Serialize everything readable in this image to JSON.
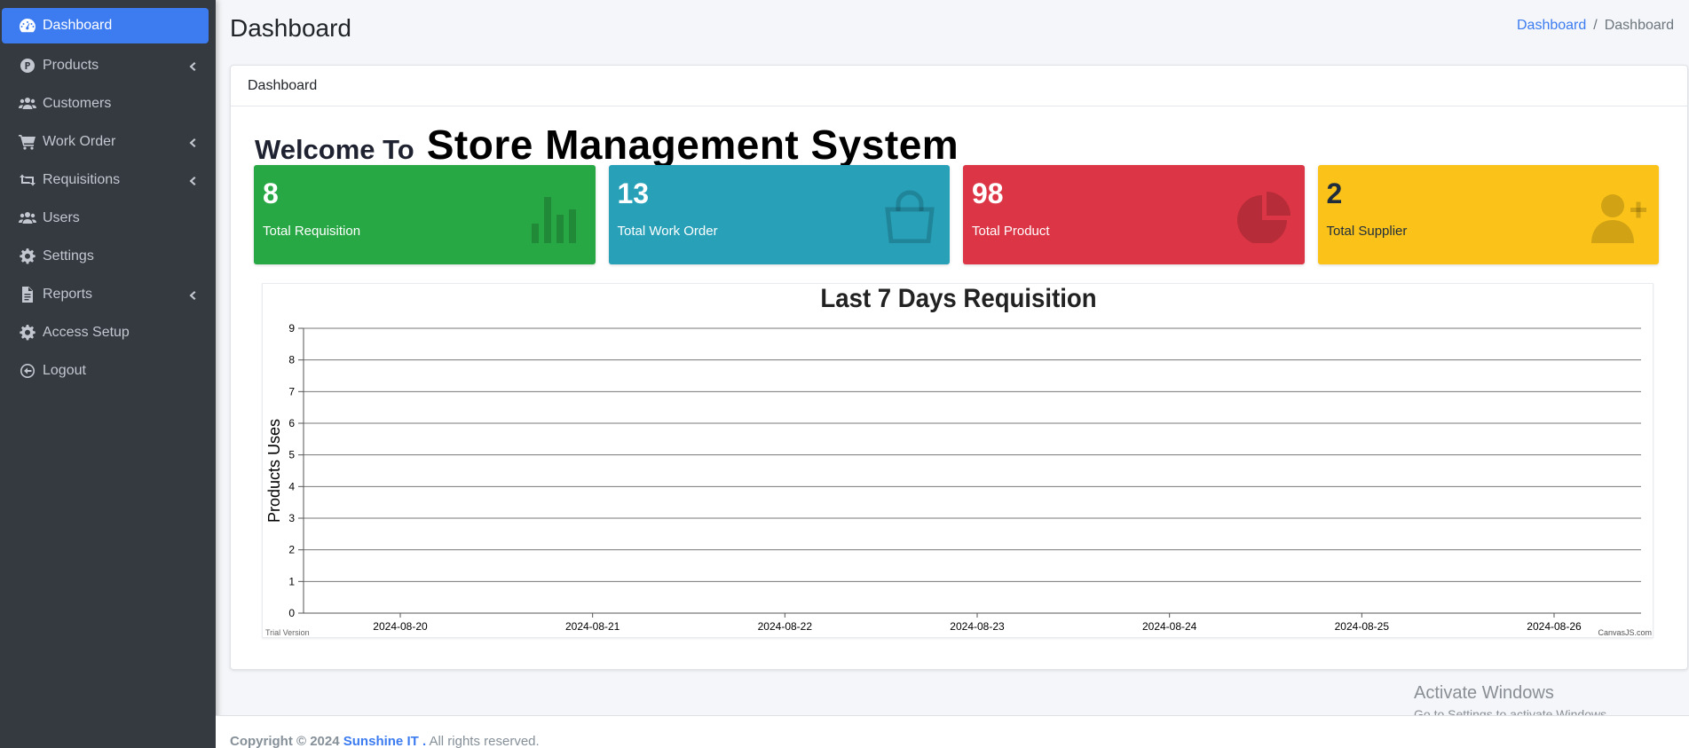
{
  "sidebar": {
    "items": [
      {
        "label": "Dashboard",
        "icon": "gauge-icon",
        "active": true,
        "caret": false
      },
      {
        "label": "Products",
        "icon": "product-p-icon",
        "active": false,
        "caret": true
      },
      {
        "label": "Customers",
        "icon": "users-icon",
        "active": false,
        "caret": false
      },
      {
        "label": "Work Order",
        "icon": "cart-icon",
        "active": false,
        "caret": true
      },
      {
        "label": "Requisitions",
        "icon": "retweet-icon",
        "active": false,
        "caret": true
      },
      {
        "label": "Users",
        "icon": "users-icon",
        "active": false,
        "caret": false
      },
      {
        "label": "Settings",
        "icon": "gear-icon",
        "active": false,
        "caret": false
      },
      {
        "label": "Reports",
        "icon": "file-icon",
        "active": false,
        "caret": true
      },
      {
        "label": "Access Setup",
        "icon": "gear-icon",
        "active": false,
        "caret": false
      },
      {
        "label": "Logout",
        "icon": "logout-icon",
        "active": false,
        "caret": false
      }
    ],
    "active_color": "#3c7cf0",
    "bg_color": "#343a40"
  },
  "header": {
    "title": "Dashboard",
    "breadcrumb": {
      "link": "Dashboard",
      "separator": "/",
      "current": "Dashboard"
    }
  },
  "card": {
    "header": "Dashboard",
    "welcome_prefix": "Welcome To",
    "welcome_main": "Store Management System"
  },
  "stats": [
    {
      "value": "8",
      "label": "Total Requisition",
      "color": "#28a745",
      "icon": "bar-chart-icon"
    },
    {
      "value": "13",
      "label": "Total Work Order",
      "color": "#27a0b8",
      "icon": "shopping-bag-icon"
    },
    {
      "value": "98",
      "label": "Total Product",
      "color": "#dc3545",
      "icon": "pie-chart-icon"
    },
    {
      "value": "2",
      "label": "Total Supplier",
      "color": "#fbc319",
      "icon": "user-plus-icon"
    }
  ],
  "chart_data": {
    "type": "line",
    "title": "Last 7 Days Requisition",
    "xlabel": "",
    "ylabel": "Products Uses",
    "categories": [
      "2024-08-20",
      "2024-08-21",
      "2024-08-22",
      "2024-08-23",
      "2024-08-24",
      "2024-08-25",
      "2024-08-26"
    ],
    "series": [],
    "ylim": [
      0,
      9
    ],
    "yticks": [
      0,
      1,
      2,
      3,
      4,
      5,
      6,
      7,
      8,
      9
    ],
    "grid": true,
    "watermark_left": "Trial Version",
    "watermark_right": "CanvasJS.com"
  },
  "overlay": {
    "line1": "Activate Windows",
    "line2": "Go to Settings to activate Windows."
  },
  "footer": {
    "prefix": "Copyright © 2024",
    "brand": "Sunshine IT .",
    "suffix": "All rights reserved."
  }
}
